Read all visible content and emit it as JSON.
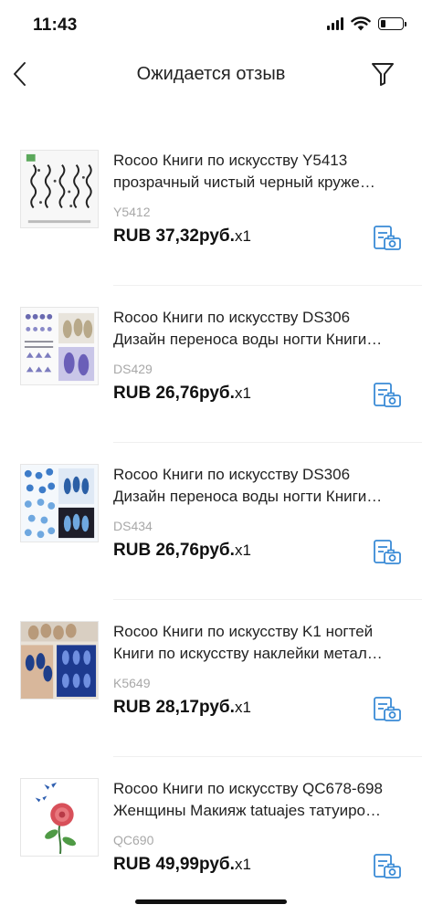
{
  "status_bar": {
    "time": "11:43"
  },
  "header": {
    "title": "Ожидается отзыв"
  },
  "icons": {
    "back": "chevron-left-icon",
    "filter": "funnel-filter-icon",
    "review": "photo-review-icon"
  },
  "colors": {
    "accent": "#3a8bd6",
    "sku_gray": "#a8a8a8",
    "text": "#111111"
  },
  "items": [
    {
      "title_line1": "Rocoo Книги по искусству Y5413",
      "title_line2": "прозрачный чистый черный круже…",
      "sku": "Y5412",
      "price": "RUB 37,32руб.",
      "qty": "x1"
    },
    {
      "title_line1": "Rocoo Книги по искусству DS306",
      "title_line2": "Дизайн переноса воды ногти Книги…",
      "sku": "DS429",
      "price": "RUB 26,76руб.",
      "qty": "x1"
    },
    {
      "title_line1": "Rocoo Книги по искусству DS306",
      "title_line2": "Дизайн переноса воды ногти Книги…",
      "sku": "DS434",
      "price": "RUB 26,76руб.",
      "qty": "x1"
    },
    {
      "title_line1": "Rocoo Книги по искусству K1 ногтей",
      "title_line2": "Книги по искусству наклейки метал…",
      "sku": "K5649",
      "price": "RUB 28,17руб.",
      "qty": "x1"
    },
    {
      "title_line1": "Rocoo Книги по искусству QC678-698",
      "title_line2": "Женщины Макияж tatuajes татуиро…",
      "sku": "QC690",
      "price": "RUB 49,99руб.",
      "qty": "x1"
    }
  ]
}
